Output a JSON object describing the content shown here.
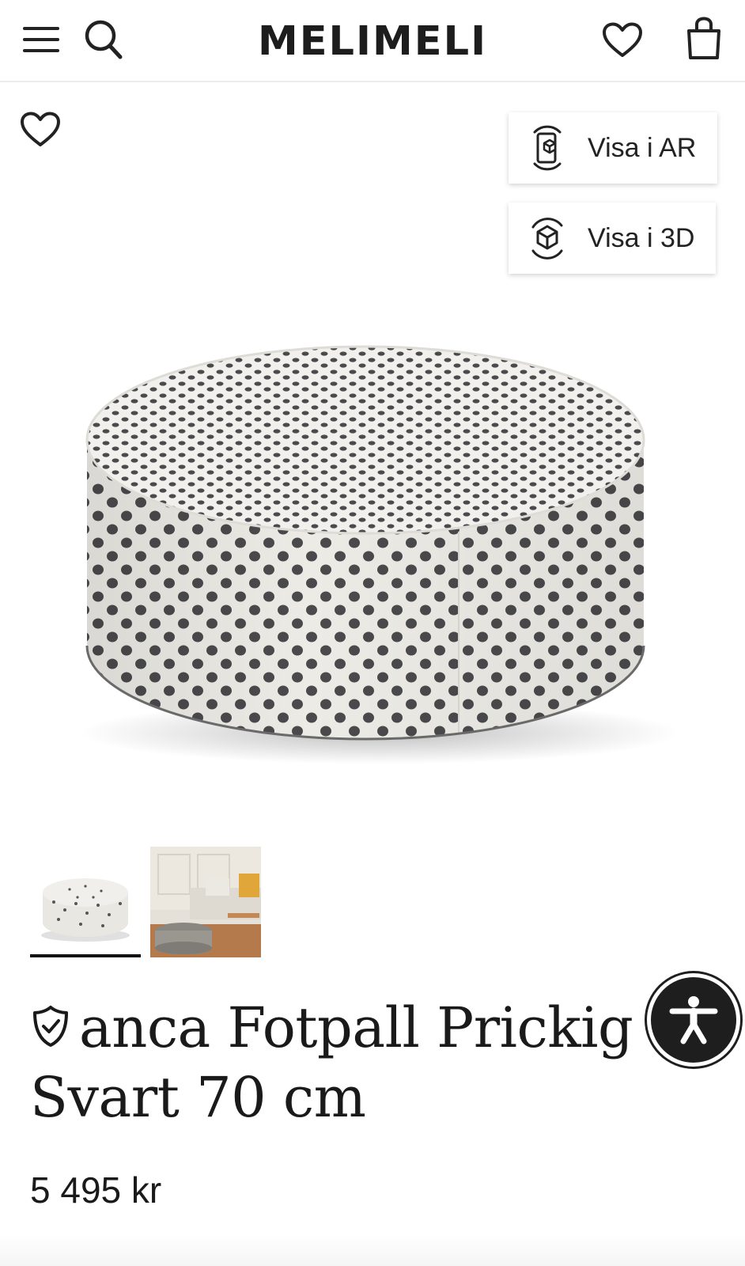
{
  "header": {
    "logo": "MELIMELI",
    "icons": [
      "menu-icon",
      "search-icon",
      "heart-icon",
      "shopping-bag-icon"
    ]
  },
  "hero": {
    "favorite_icon": "heart-outline-icon",
    "view_ar_label": "Visa i AR",
    "view_3d_label": "Visa i 3D"
  },
  "thumbnails": {
    "count": 2,
    "active_index": 0
  },
  "product": {
    "title_line1": "anca Fotpall Prickig",
    "title_line2": "Svart 70 cm",
    "price": "5 495 kr",
    "badge_icon": "shield-check-icon"
  },
  "accessibility": {
    "icon": "accessibility-person-icon"
  },
  "colors": {
    "text": "#1a1a1a",
    "fabric": "#ecebe6",
    "dots": "#4a4a4c",
    "divider": "#ececec"
  }
}
